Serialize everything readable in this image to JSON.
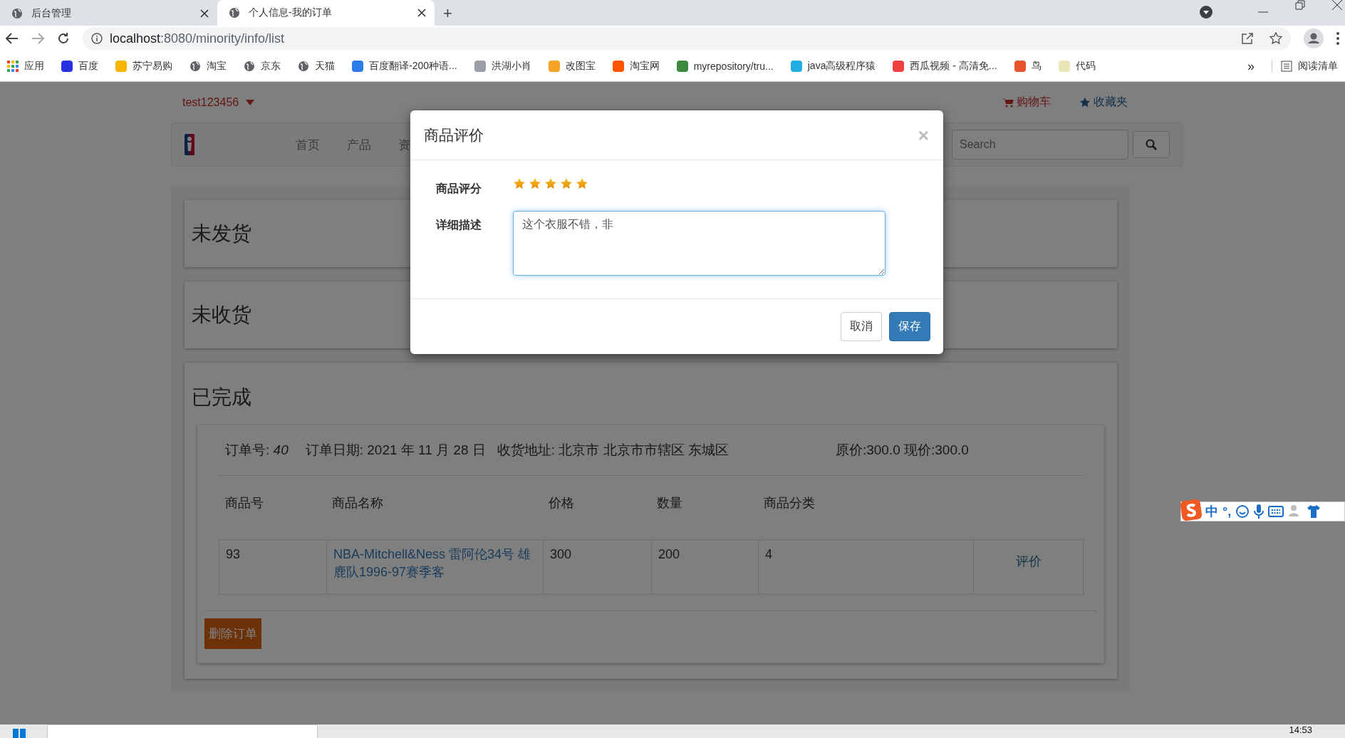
{
  "browser": {
    "tabs": [
      {
        "title": "后台管理",
        "selected": false
      },
      {
        "title": "个人信息-我的订单",
        "selected": true
      }
    ],
    "new_tab": "+",
    "address": {
      "host": "localhost",
      "path": ":8080/minority/info/list"
    },
    "bookmarks": [
      {
        "label": "应用",
        "kind": "apps"
      },
      {
        "label": "百度",
        "kind": "tile",
        "color": "#2932e1"
      },
      {
        "label": "苏宁易购",
        "kind": "tile",
        "color": "#f5b400"
      },
      {
        "label": "淘宝",
        "kind": "globe"
      },
      {
        "label": "京东",
        "kind": "globe"
      },
      {
        "label": "天猫",
        "kind": "globe"
      },
      {
        "label": "百度翻译-200种语...",
        "kind": "tile",
        "color": "#2b7de9"
      },
      {
        "label": "洪湖小肖",
        "kind": "tile",
        "color": "#9aa0a6"
      },
      {
        "label": "改图宝",
        "kind": "tile",
        "color": "#f7a325"
      },
      {
        "label": "淘宝网",
        "kind": "tile",
        "color": "#ff5500"
      },
      {
        "label": "myrepository/tru...",
        "kind": "tile",
        "color": "#3c8a3e"
      },
      {
        "label": "java高级程序猿",
        "kind": "tile",
        "color": "#23ade5"
      },
      {
        "label": "西瓜视频 - 高清免...",
        "kind": "tile",
        "color": "#f04142"
      },
      {
        "label": "鸟",
        "kind": "tile",
        "color": "#e8542c"
      },
      {
        "label": "代码",
        "kind": "tile",
        "color": "#e9e6b8"
      }
    ],
    "bookmarks_overflow": "»",
    "reading_list": "阅读清单"
  },
  "site": {
    "user": "test123456",
    "cart": "购物车",
    "favorites": "收藏夹",
    "nav": [
      "首页",
      "产品",
      "资"
    ],
    "search": {
      "placeholder": "Search"
    }
  },
  "sections": [
    {
      "title": "未发货"
    },
    {
      "title": "未收货"
    },
    {
      "title": "已完成"
    }
  ],
  "order": {
    "number_label": "订单号: ",
    "number": "40",
    "date": "订单日期: 2021 年 11 月 28 日",
    "address": "收货地址: 北京市 北京市市辖区 东城区",
    "price": "原价:300.0 现价:300.0",
    "columns": [
      "商品号",
      "商品名称",
      "价格",
      "数量",
      "商品分类"
    ],
    "rows": [
      {
        "id": "93",
        "name": "NBA-Mitchell&Ness 雷阿伦34号 雄鹿队1996-97赛季客",
        "price": "300",
        "quantity": "200",
        "category": "4",
        "action": "评价"
      }
    ],
    "delete": "删除订单"
  },
  "modal": {
    "title": "商品评价",
    "close": "×",
    "fields": [
      {
        "kind": "rating",
        "label": "商品评分",
        "stars": 5
      },
      {
        "kind": "textarea",
        "label": "详细描述",
        "value": "这个衣服不错，非",
        "focused": true
      }
    ],
    "buttons": [
      {
        "label": "取消",
        "kind": "default"
      },
      {
        "label": "保存",
        "kind": "primary"
      }
    ]
  },
  "ime": {
    "mode": "中",
    "punct": "°,"
  },
  "taskbar": {
    "clock": "14:53"
  }
}
